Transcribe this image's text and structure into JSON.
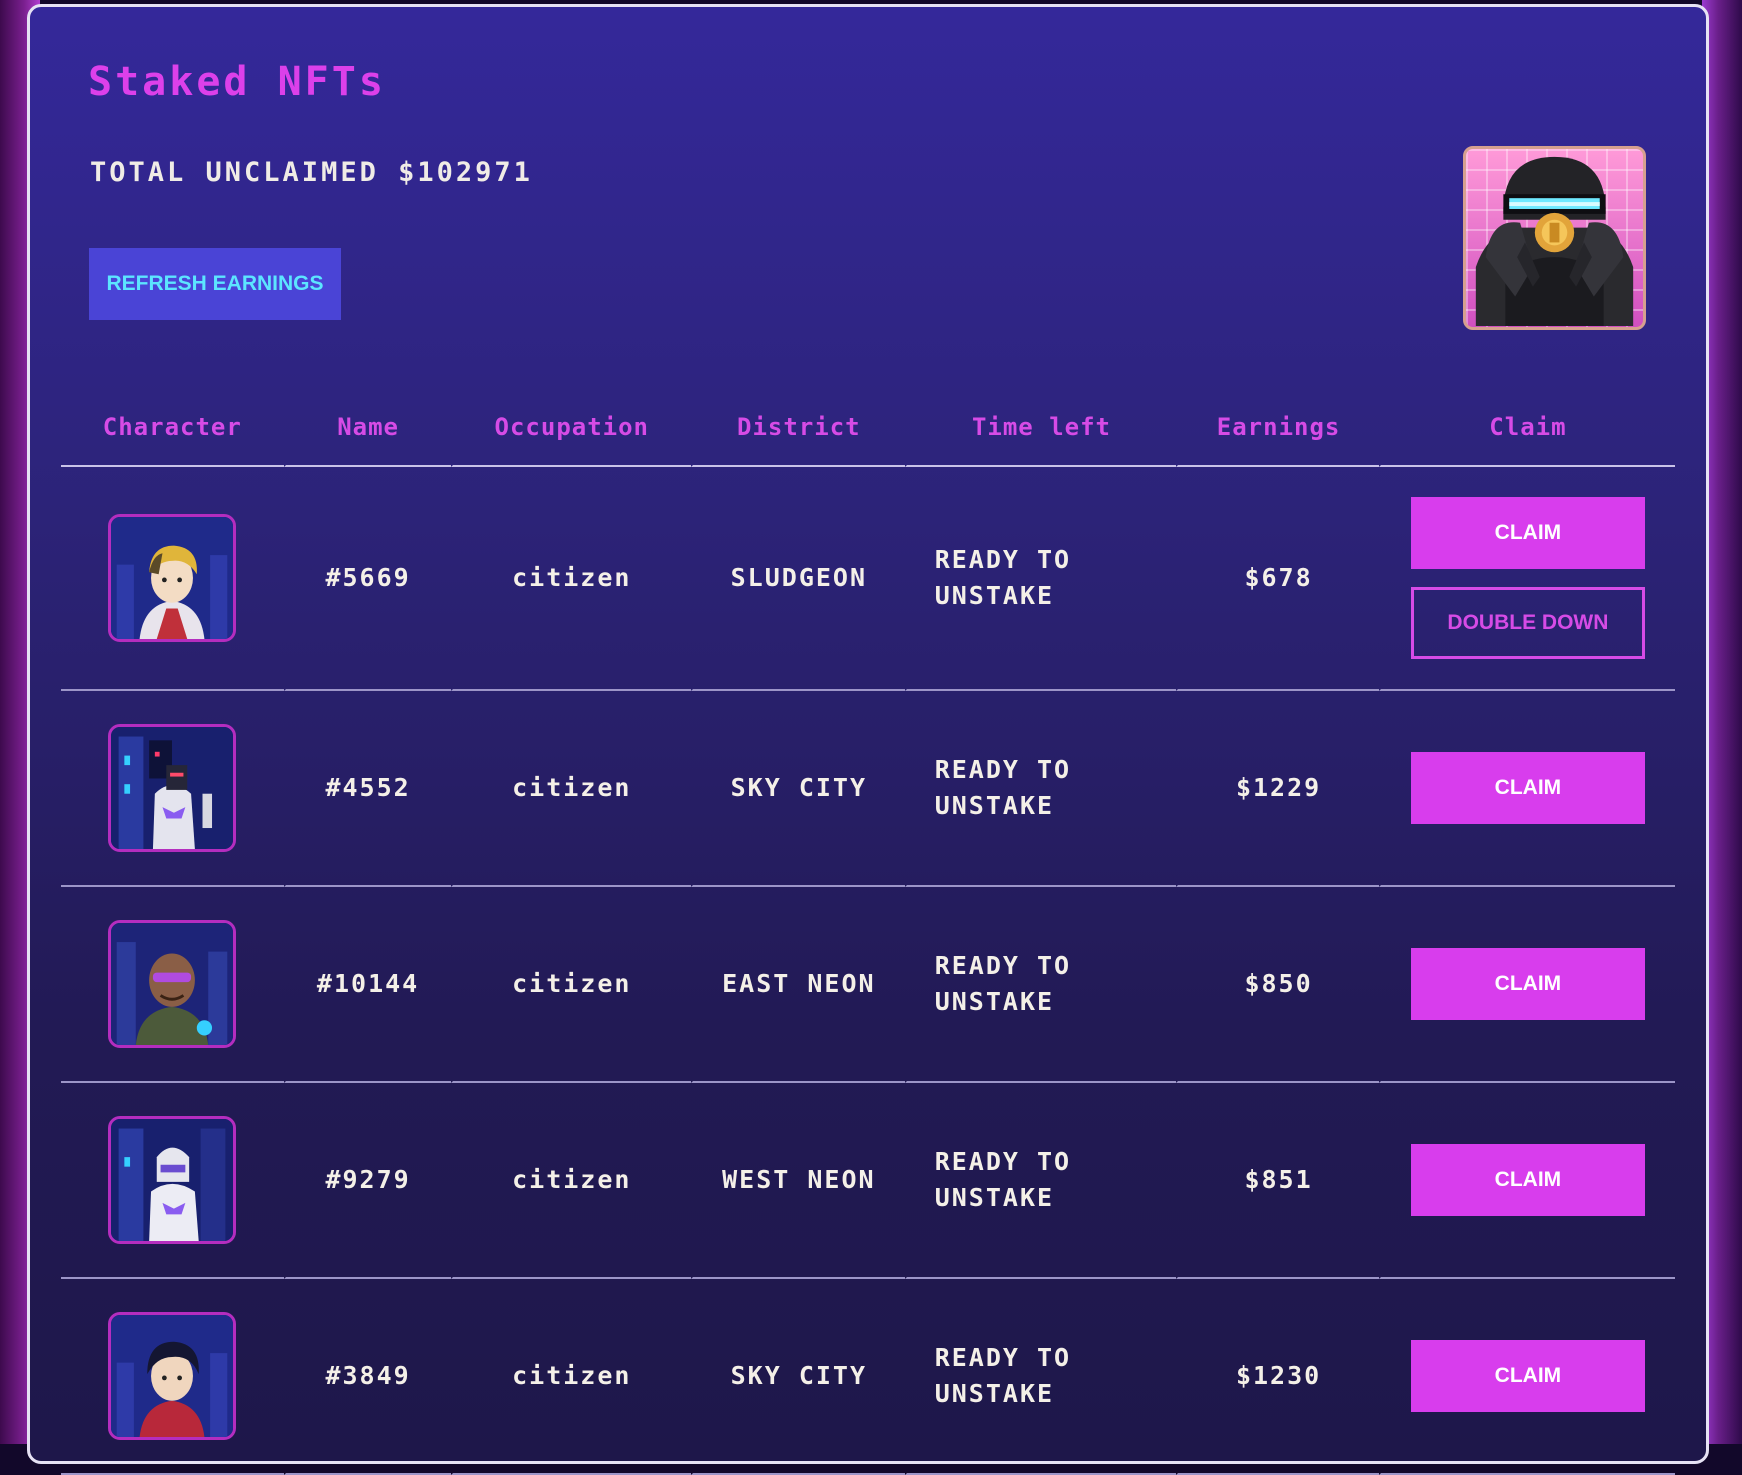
{
  "page": {
    "title": "Staked NFTs",
    "total_unclaimed": "TOTAL UNCLAIMED $102971",
    "refresh_label": "REFRESH EARNINGS"
  },
  "table": {
    "headers": [
      "Character",
      "Name",
      "Occupation",
      "District",
      "Time left",
      "Earnings",
      "Claim"
    ],
    "rows": [
      {
        "name": "#5669",
        "occupation": "citizen",
        "district": "SLUDGEON",
        "time_left": "READY TO UNSTAKE",
        "earnings": "$678",
        "claim_label": "CLAIM",
        "double_down_label": "DOUBLE DOWN"
      },
      {
        "name": "#4552",
        "occupation": "citizen",
        "district": "SKY CITY",
        "time_left": "READY TO UNSTAKE",
        "earnings": "$1229",
        "claim_label": "CLAIM"
      },
      {
        "name": "#10144",
        "occupation": "citizen",
        "district": "EAST NEON",
        "time_left": "READY TO UNSTAKE",
        "earnings": "$850",
        "claim_label": "CLAIM"
      },
      {
        "name": "#9279",
        "occupation": "citizen",
        "district": "WEST NEON",
        "time_left": "READY TO UNSTAKE",
        "earnings": "$851",
        "claim_label": "CLAIM"
      },
      {
        "name": "#3849",
        "occupation": "citizen",
        "district": "SKY CITY",
        "time_left": "READY TO UNSTAKE",
        "earnings": "$1230",
        "claim_label": "CLAIM"
      }
    ]
  },
  "colors": {
    "accent": "#d83ded",
    "refresh_bg": "#4a44d6",
    "refresh_text": "#5ce5ff"
  }
}
